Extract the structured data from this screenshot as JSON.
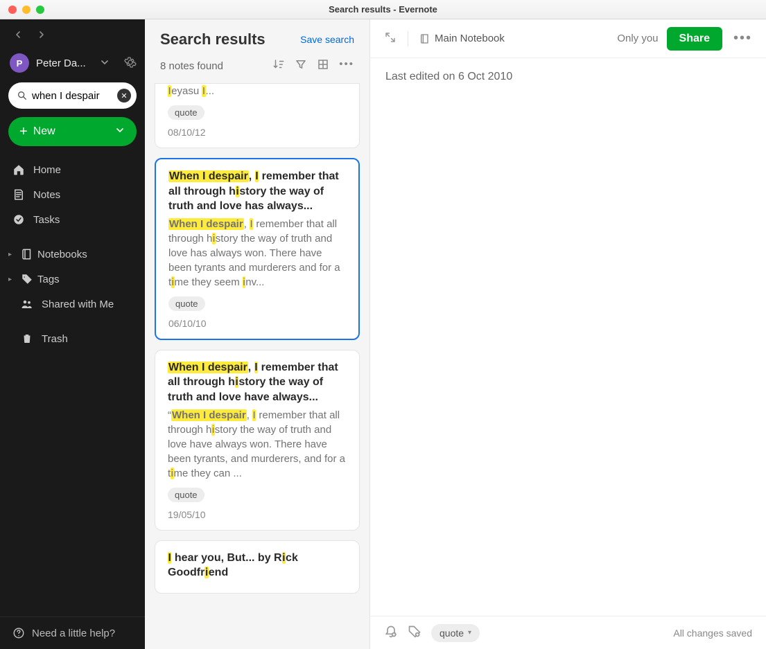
{
  "window": {
    "title": "Search results - Evernote"
  },
  "sidebar": {
    "avatar_initial": "P",
    "username": "Peter Da...",
    "search_value": "when I despair",
    "new_label": "New",
    "nav": {
      "home": "Home",
      "notes": "Notes",
      "tasks": "Tasks",
      "notebooks": "Notebooks",
      "tags": "Tags",
      "shared": "Shared with Me",
      "trash": "Trash"
    },
    "help": "Need a little help?"
  },
  "mid": {
    "title": "Search results",
    "save_search": "Save search",
    "count": "8 notes found"
  },
  "results": [
    {
      "partial_top": true,
      "title_fragment": "Ieyasu I...",
      "tag": "quote",
      "date": "08/10/12"
    },
    {
      "selected": true,
      "title_segments": [
        {
          "t": "When I despair",
          "hl": "phrase"
        },
        {
          "t": ", "
        },
        {
          "t": "I",
          "hl": "char"
        },
        {
          "t": " remember that all through h"
        },
        {
          "t": "i",
          "hl": "char"
        },
        {
          "t": "story the way of truth and love has always..."
        }
      ],
      "body_segments": [
        {
          "t": "When I despair",
          "hl": "phrase"
        },
        {
          "t": ", "
        },
        {
          "t": "I",
          "hl": "char"
        },
        {
          "t": " remember that all through h"
        },
        {
          "t": "i",
          "hl": "char"
        },
        {
          "t": "story the way of truth and love has always won. There have been tyrants and murderers and for a t"
        },
        {
          "t": "i",
          "hl": "char"
        },
        {
          "t": "me they seem "
        },
        {
          "t": "i",
          "hl": "char"
        },
        {
          "t": "nv..."
        }
      ],
      "tag": "quote",
      "date": "06/10/10"
    },
    {
      "title_segments": [
        {
          "t": "When I despair",
          "hl": "phrase"
        },
        {
          "t": ", "
        },
        {
          "t": "I",
          "hl": "char"
        },
        {
          "t": " remember that all through h"
        },
        {
          "t": "i",
          "hl": "char"
        },
        {
          "t": "story the way of truth and love have always..."
        }
      ],
      "body_segments": [
        {
          "t": "“"
        },
        {
          "t": "When I despair",
          "hl": "phrase"
        },
        {
          "t": ", "
        },
        {
          "t": "I",
          "hl": "char"
        },
        {
          "t": " remember that all through h"
        },
        {
          "t": "i",
          "hl": "char"
        },
        {
          "t": "story the way of truth and love have always won. There have been tyrants, and murderers, and for a t"
        },
        {
          "t": "i",
          "hl": "char"
        },
        {
          "t": "me they can ..."
        }
      ],
      "tag": "quote",
      "date": "19/05/10"
    },
    {
      "title_segments": [
        {
          "t": "I",
          "hl": "char"
        },
        {
          "t": " hear you, But... by R"
        },
        {
          "t": "i",
          "hl": "char"
        },
        {
          "t": "ck Goodfr"
        },
        {
          "t": "i",
          "hl": "char"
        },
        {
          "t": "end"
        }
      ],
      "cutoff": true
    }
  ],
  "editor": {
    "notebook": "Main Notebook",
    "only_you": "Only you",
    "share": "Share",
    "meta": "Last edited on 6 Oct 2010",
    "footer_tag": "quote",
    "saved": "All changes saved"
  }
}
